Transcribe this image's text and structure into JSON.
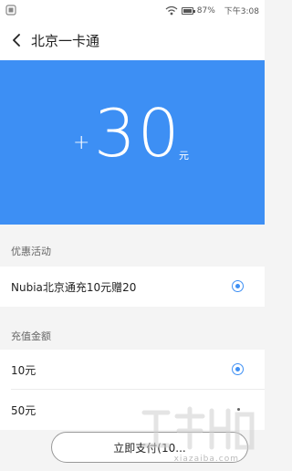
{
  "status_bar": {
    "battery": "87%",
    "time": "下午3:08"
  },
  "app_bar": {
    "title": "北京一卡通"
  },
  "amount": {
    "plus": "+",
    "value": "30",
    "unit": "元"
  },
  "promotions": {
    "header": "优惠活动",
    "items": [
      {
        "label": "Nubia北京通充10元赠20",
        "selected": true
      }
    ]
  },
  "recharge": {
    "header": "充值金额",
    "options": [
      {
        "label": "10元",
        "selected": true
      },
      {
        "label": "50元",
        "selected": false
      }
    ]
  },
  "pay_button": {
    "label": "立即支付(10..."
  },
  "watermark": {
    "text": "xiazaiba.com"
  },
  "colors": {
    "accent": "#3d8ff4",
    "background": "#f4f4f4"
  }
}
